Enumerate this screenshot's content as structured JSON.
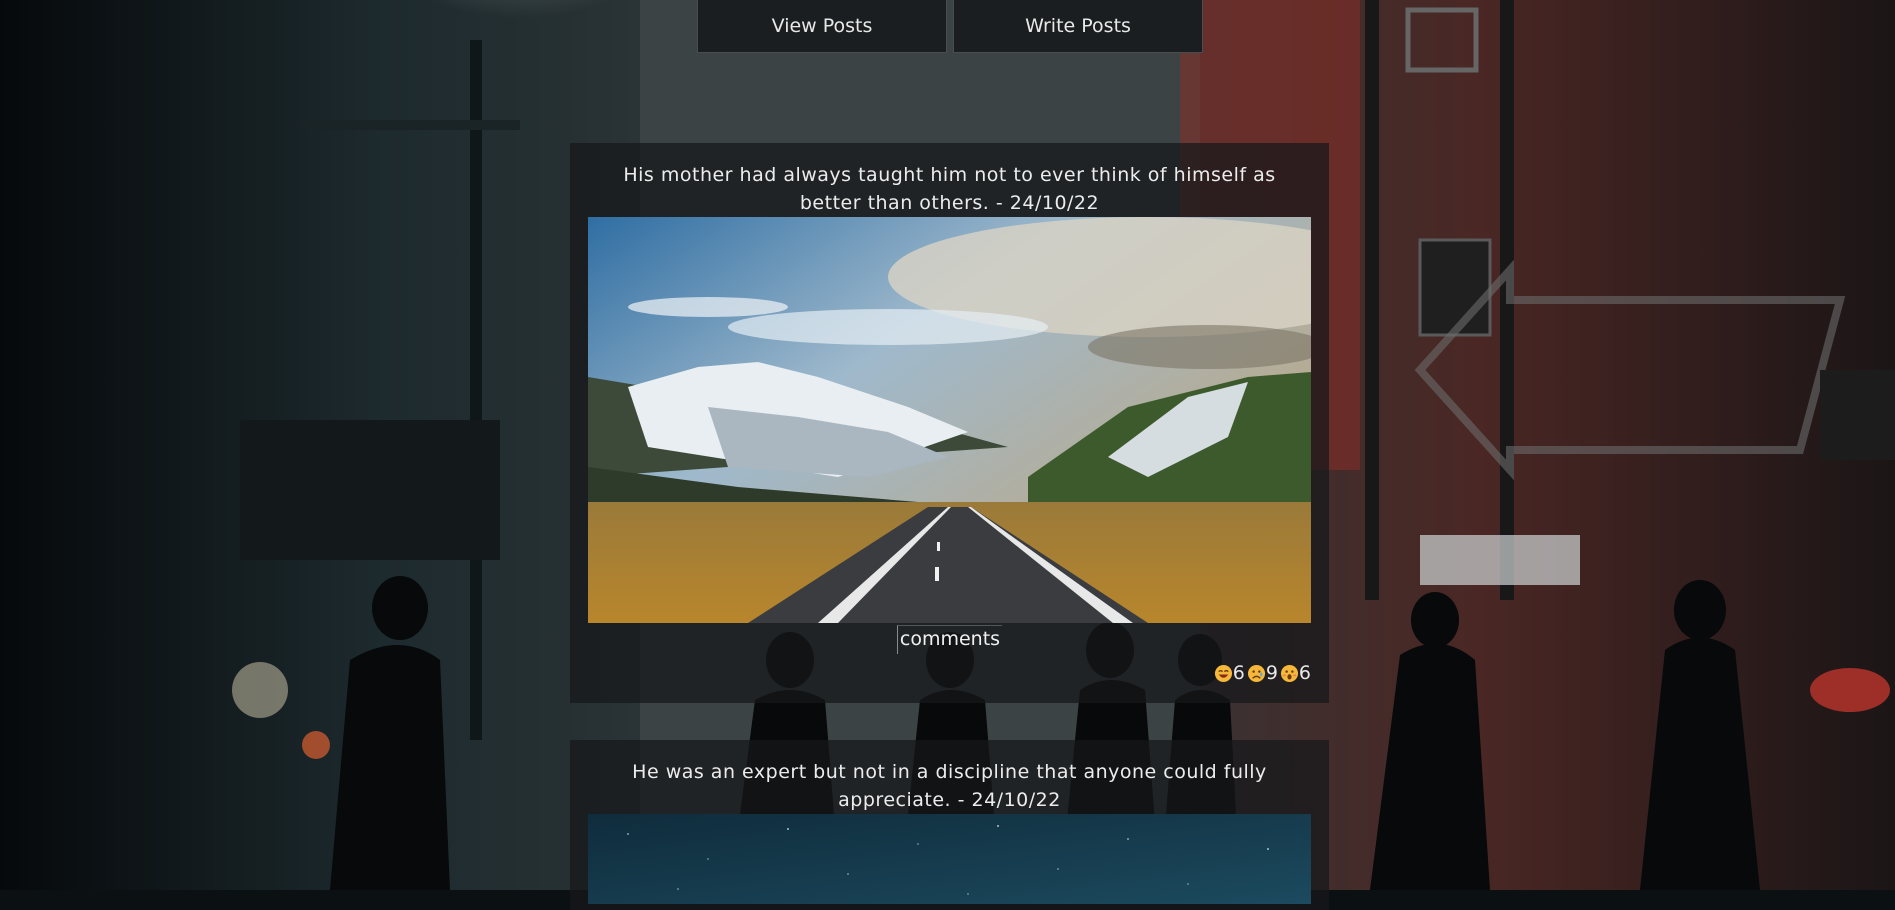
{
  "nav": {
    "view_label": "View Posts",
    "write_label": "Write Posts"
  },
  "posts": [
    {
      "text": "His mother had always taught him not to ever think of himself as better than others. - 24/10/22",
      "comments_label": "comments",
      "reactions": [
        {
          "icon": "laughing-emoji-icon",
          "count": "6"
        },
        {
          "icon": "sad-emoji-icon",
          "count": "9"
        },
        {
          "icon": "surprised-emoji-icon",
          "count": "6"
        }
      ]
    },
    {
      "text": "He was an expert but not in a discipline that anyone could fully appreciate. - 24/10/22"
    }
  ],
  "colors": {
    "nav_bg": "#1b1e20",
    "card_bg": "rgba(22,24,26,0.72)",
    "neon_red": "#b4332c",
    "text": "#e8e8e8"
  }
}
